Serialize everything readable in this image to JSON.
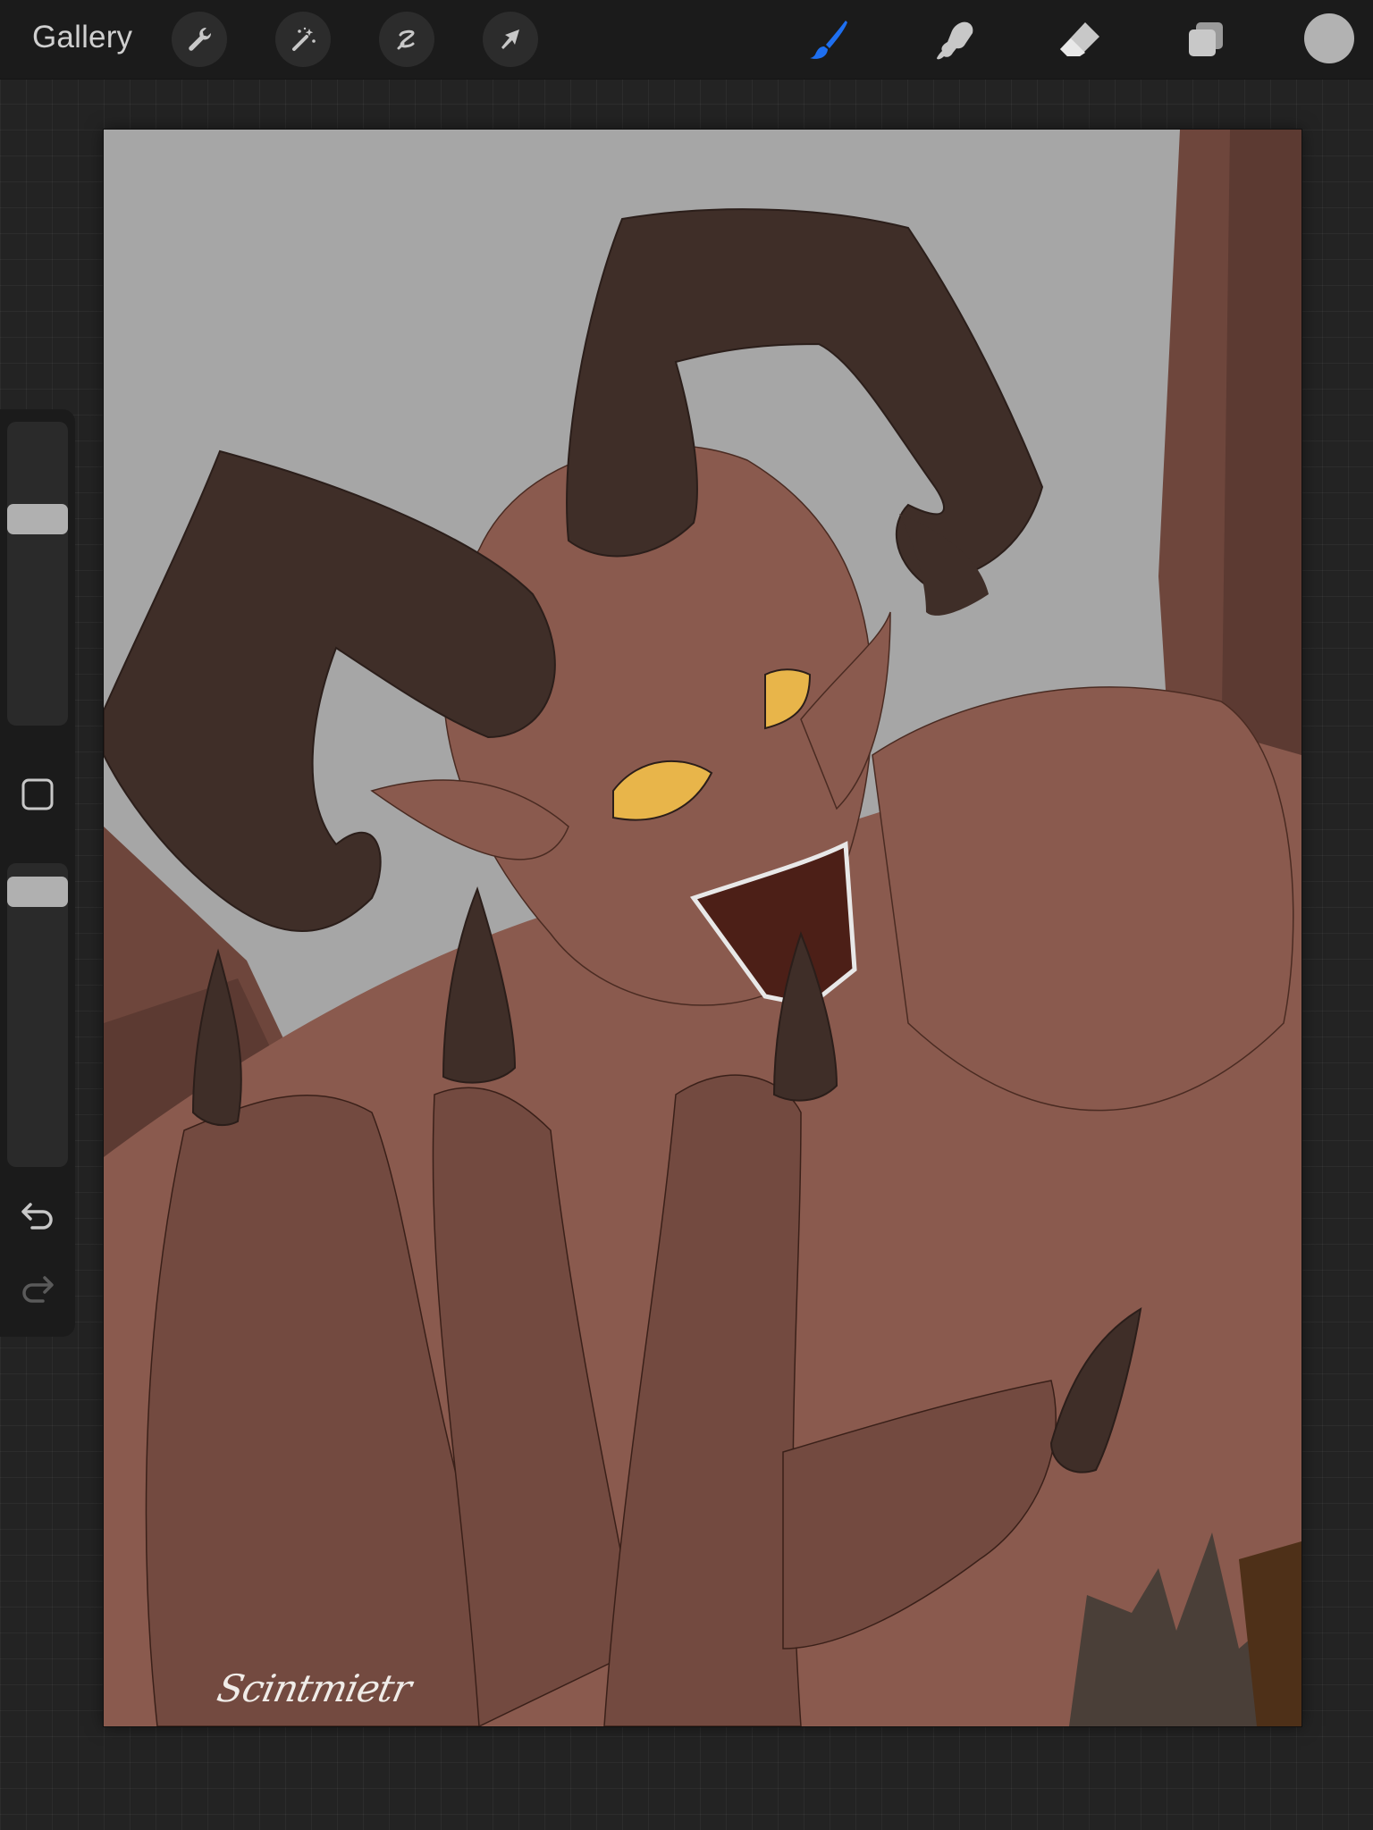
{
  "app": {
    "gallery_label": "Gallery"
  },
  "toolbar": {
    "left_tools": [
      {
        "name": "actions",
        "icon": "wrench-icon"
      },
      {
        "name": "adjustments",
        "icon": "magic-wand-icon"
      },
      {
        "name": "selection",
        "icon": "selection-s-icon"
      },
      {
        "name": "transform",
        "icon": "arrow-cursor-icon"
      }
    ],
    "right_tools": [
      {
        "name": "brush",
        "icon": "brush-icon",
        "active": true
      },
      {
        "name": "smudge",
        "icon": "smudge-finger-icon",
        "active": false
      },
      {
        "name": "eraser",
        "icon": "eraser-icon",
        "active": false
      },
      {
        "name": "layers",
        "icon": "layers-icon",
        "active": false
      }
    ],
    "current_color": "#b2b2b2",
    "active_color": "#1e6ff0"
  },
  "sidebar": {
    "brush_size_level": 0.7,
    "opacity_level": 0.95,
    "modify_icon": "square-icon",
    "undo_icon": "undo-icon",
    "redo_icon": "redo-icon",
    "redo_enabled": false
  },
  "canvas": {
    "artwork": "horned-demon-illustration",
    "signature": "Scintmietr",
    "palette": {
      "background": "#a6a6a6",
      "skin": "#8a5a4e",
      "skin_dark": "#734a40",
      "horn": "#3f2e28",
      "eye": "#e8b54a",
      "mouth": "#4c1f17",
      "wing": "#6e463c"
    }
  }
}
